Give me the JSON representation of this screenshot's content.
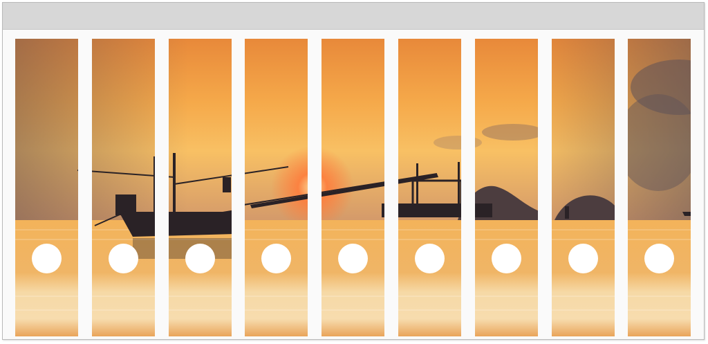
{
  "label_sheet": {
    "strip_count": 9,
    "finger_hole_count": 9,
    "photo": {
      "subject": "sunset-sea-fishing-boat",
      "sky_colors": [
        "#e8893a",
        "#f5a94a",
        "#f8c064"
      ],
      "sun_color": "#ff7a3a",
      "water_colors": [
        "#f3b35a",
        "#f6d9a6",
        "#e9a45a"
      ],
      "silhouette_color": "#2a2226",
      "island_color": "#4c3d3f"
    }
  }
}
